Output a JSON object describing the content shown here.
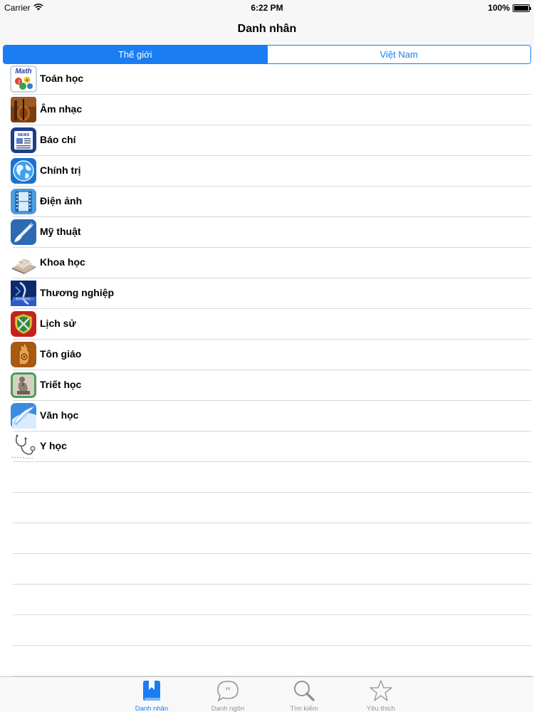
{
  "status_bar": {
    "carrier": "Carrier",
    "time": "6:22 PM",
    "battery_percent": "100%",
    "battery_level": 1.0
  },
  "nav": {
    "title": "Danh nhân"
  },
  "segments": [
    {
      "label": "Thế giới",
      "selected": true
    },
    {
      "label": "Việt Nam",
      "selected": false
    }
  ],
  "categories": [
    {
      "label": "Toán học",
      "icon": "math-icon"
    },
    {
      "label": "Âm nhạc",
      "icon": "violin-icon"
    },
    {
      "label": "Báo chí",
      "icon": "newspaper-icon"
    },
    {
      "label": "Chính trị",
      "icon": "globe-icon"
    },
    {
      "label": "Điện ảnh",
      "icon": "film-icon"
    },
    {
      "label": "Mỹ thuật",
      "icon": "paintbrush-icon"
    },
    {
      "label": "Khoa học",
      "icon": "science-books-icon"
    },
    {
      "label": "Thương nghiệp",
      "icon": "commerce-icon"
    },
    {
      "label": "Lịch sử",
      "icon": "shield-swords-icon"
    },
    {
      "label": "Tôn giáo",
      "icon": "hand-icon"
    },
    {
      "label": "Triết học",
      "icon": "thinker-icon"
    },
    {
      "label": "Văn học",
      "icon": "quill-icon"
    },
    {
      "label": "Y học",
      "icon": "stethoscope-icon"
    }
  ],
  "tabs": [
    {
      "label": "Danh nhân",
      "icon": "bookmark-book-icon",
      "active": true
    },
    {
      "label": "Danh ngôn",
      "icon": "quote-bubble-icon",
      "active": false
    },
    {
      "label": "Tìm kiếm",
      "icon": "search-icon",
      "active": false
    },
    {
      "label": "Yêu thích",
      "icon": "star-icon",
      "active": false
    }
  ],
  "colors": {
    "accent": "#1a7df2",
    "inactive_tab": "#929292"
  }
}
